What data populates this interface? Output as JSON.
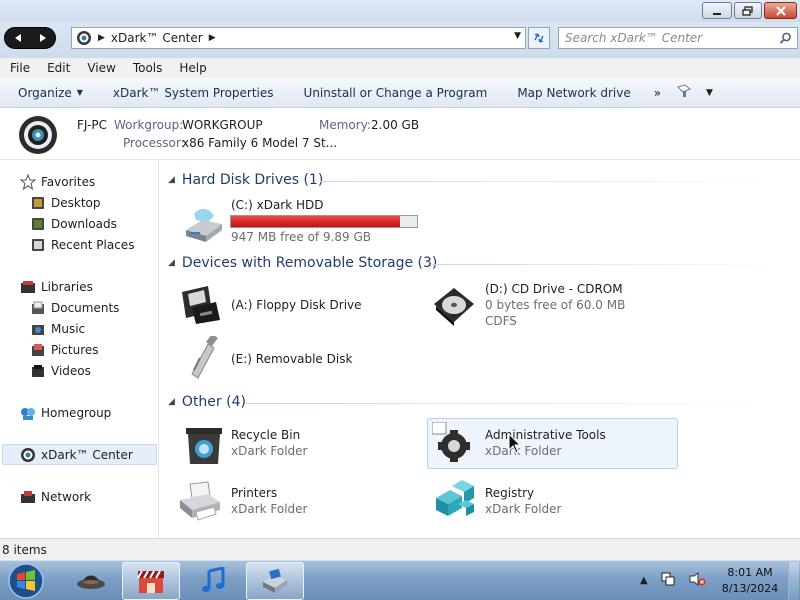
{
  "window": {
    "controls": {
      "minimize_icon": "minimize-icon",
      "maximize_icon": "maximize-icon",
      "close_icon": "close-icon"
    }
  },
  "address": {
    "segment": "xDark™ Center",
    "search_placeholder": "Search xDark™ Center"
  },
  "menu": [
    "File",
    "Edit",
    "View",
    "Tools",
    "Help"
  ],
  "toolbar": {
    "organize": "Organize",
    "system_properties": "xDark™ System Properties",
    "uninstall": "Uninstall or Change a Program",
    "map_drive": "Map Network drive",
    "more": "»"
  },
  "details": {
    "computer_name": "FJ-PC",
    "workgroup_label": "Workgroup:",
    "workgroup_value": "WORKGROUP",
    "memory_label": "Memory:",
    "memory_value": "2.00 GB",
    "processor_label": "Processor:",
    "processor_value": "x86 Family 6 Model 7 St..."
  },
  "nav": {
    "favorites": "Favorites",
    "desktop": "Desktop",
    "downloads": "Downloads",
    "recent": "Recent Places",
    "libraries": "Libraries",
    "documents": "Documents",
    "music": "Music",
    "pictures": "Pictures",
    "videos": "Videos",
    "homegroup": "Homegroup",
    "center": "xDark™ Center",
    "network": "Network"
  },
  "groups": {
    "hdd": {
      "title": "Hard Disk Drives (1)",
      "items": [
        {
          "name": "(C:) xDark HDD",
          "free": "947 MB free of 9.89 GB",
          "used_fraction": 0.906
        }
      ]
    },
    "removable": {
      "title": "Devices with Removable Storage (3)",
      "floppy": "(A:) Floppy Disk Drive",
      "cd_name": "(D:) CD Drive - CDROM",
      "cd_free": "0 bytes free of 60.0 MB",
      "cd_fs": "CDFS",
      "removable": "(E:) Removable Disk"
    },
    "other": {
      "title": "Other (4)",
      "recycle": "Recycle Bin",
      "recycle_sub": "xDark Folder",
      "admin": "Administrative Tools",
      "admin_sub": "xDark Folder",
      "printers": "Printers",
      "printers_sub": "xDark Folder",
      "registry": "Registry",
      "registry_sub": "xDark Folder"
    }
  },
  "status": {
    "items": "8 items"
  },
  "taskbar": {
    "time": "8:01 AM",
    "date": "8/13/2024"
  }
}
